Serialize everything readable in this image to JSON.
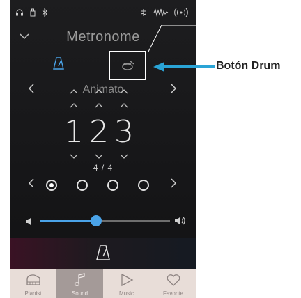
{
  "status_bar": {
    "icons": [
      "headphones-icon",
      "usb-icon",
      "bluetooth-icon",
      "music-settings-icon",
      "sound-wave-icon",
      "wireless-icon"
    ]
  },
  "header": {
    "title": "Metronome",
    "collapse_icon": "chevron-down-icon"
  },
  "mode_tabs": [
    {
      "name": "metronome-mode",
      "icon": "metronome-icon",
      "active": true
    },
    {
      "name": "drum-mode",
      "icon": "drum-icon",
      "active": false
    }
  ],
  "rhythm": {
    "label": "Animato"
  },
  "tempo": {
    "digits": [
      "1",
      "2",
      "3"
    ]
  },
  "time_signature": "4 / 4",
  "beats": {
    "count": 4,
    "selected_index": 0
  },
  "volume": {
    "level_percent": 43
  },
  "tabs": [
    {
      "label": "Pianist",
      "icon": "piano-icon",
      "active": false
    },
    {
      "label": "Sound",
      "icon": "note-icon",
      "active": true
    },
    {
      "label": "Music",
      "icon": "play-icon",
      "active": false
    },
    {
      "label": "Favorite",
      "icon": "heart-icon",
      "active": false
    }
  ],
  "callout": {
    "label": "Botón Drum"
  },
  "colors": {
    "accent": "#4aa3e8",
    "callout_arrow": "#2aa4d6",
    "background": "#1b1b1d",
    "tabbar": "#e8ddd8"
  }
}
